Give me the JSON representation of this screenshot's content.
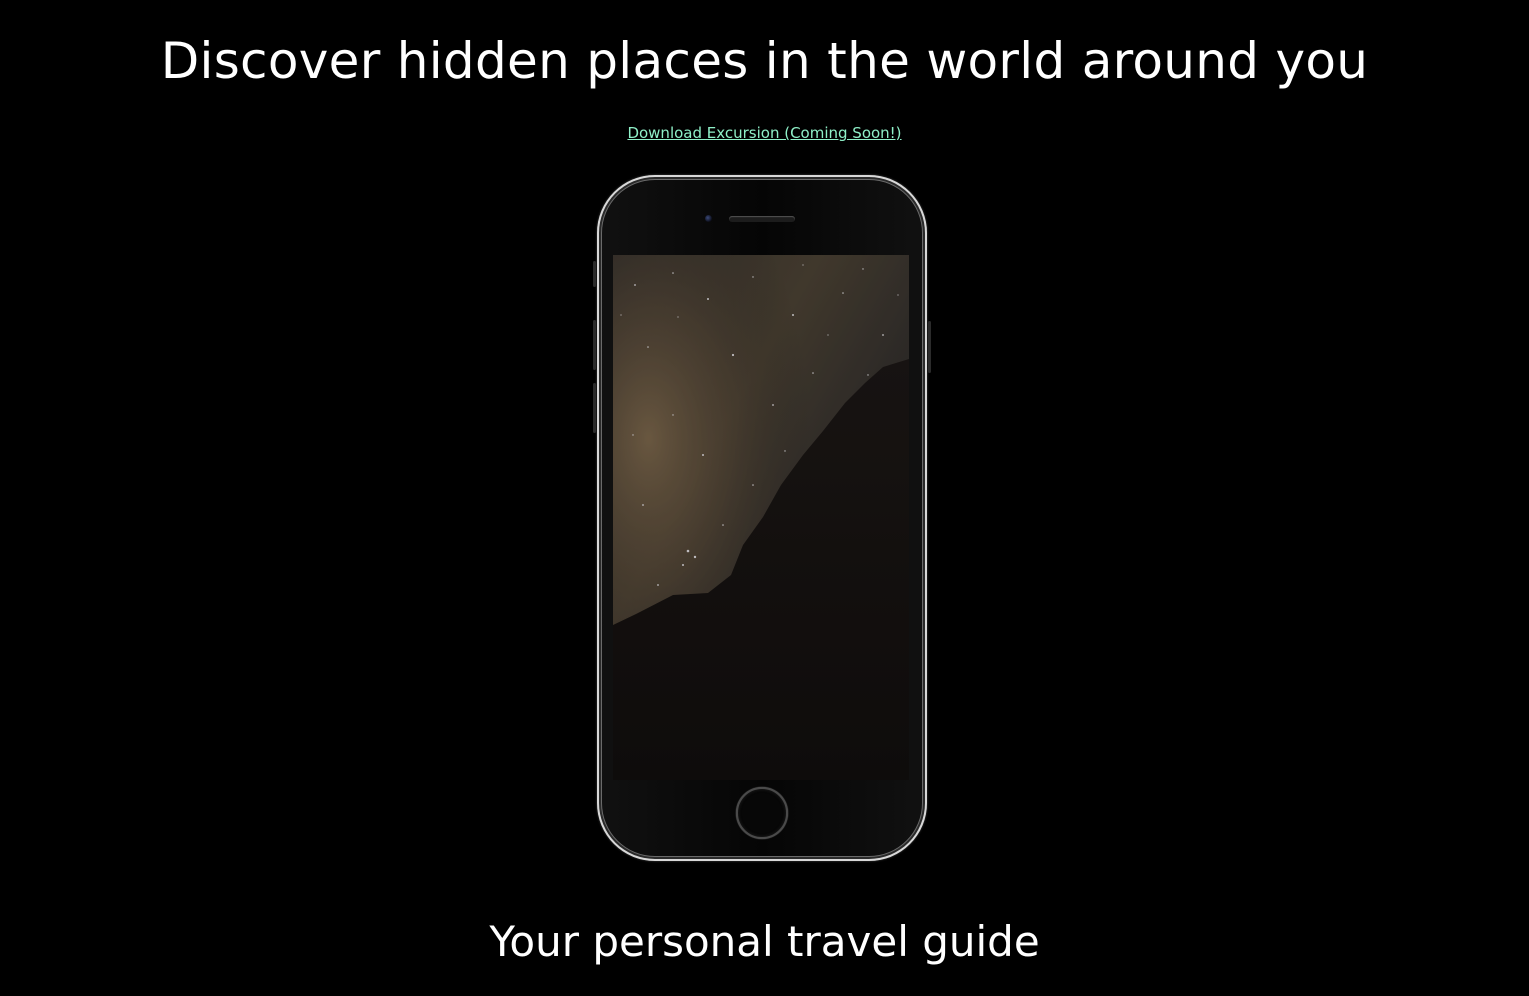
{
  "hero": {
    "headline": "Discover hidden places in the world around you",
    "download_link_label": "Download Excursion (Coming Soon!)",
    "tagline": "Your personal travel guide"
  },
  "phone_mockup": {
    "screen_image": "night-sky-milky-way-over-rock-formation",
    "camera_icon": "front-camera-icon",
    "home_button_icon": "home-button-icon"
  },
  "colors": {
    "background": "#000000",
    "text": "#ffffff",
    "link": "#8ff0c8"
  }
}
